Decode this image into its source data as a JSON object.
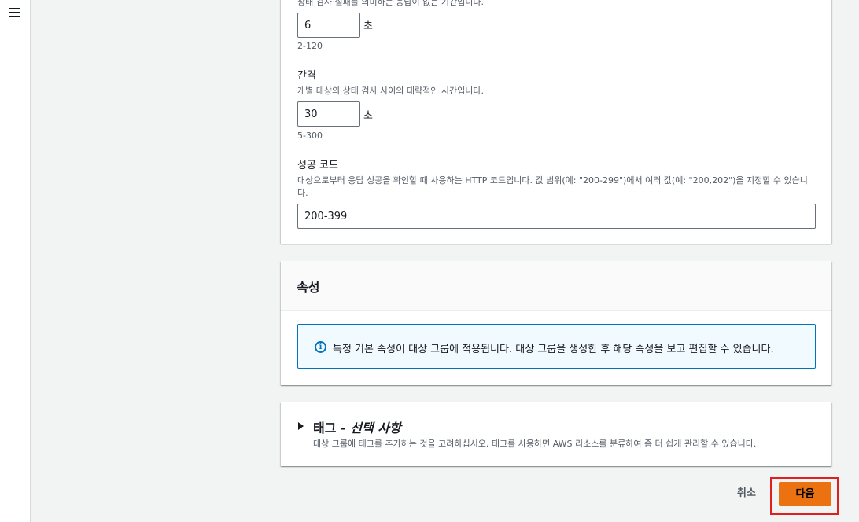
{
  "nav": {
    "menu_icon": "hamburger-menu-icon"
  },
  "health_check": {
    "timeout": {
      "description": "상태 검사 실패를 의미하는 응답이 없는 기간입니다.",
      "value": "6",
      "unit": "초",
      "range": "2-120"
    },
    "interval": {
      "label": "간격",
      "description": "개별 대상의 상태 검사 사이의 대략적인 시간입니다.",
      "value": "30",
      "unit": "초",
      "range": "5-300"
    },
    "success_codes": {
      "label": "성공 코드",
      "description_line1": "대상으로부터 응답 성공을 확인할 때 사용하는 HTTP 코드입니다. 값 범위(예: \"200-299\")에서 여러 값(예: \"200,202\")을 지정할 수 있습니",
      "description_line2": "다.",
      "value": "200-399"
    }
  },
  "attributes": {
    "title": "속성",
    "info_icon": "info-icon",
    "info_text": "특정 기본 속성이 대상 그룹에 적용됩니다. 대상 그룹을 생성한 후 해당 속성을 보고 편집할 수 있습니다."
  },
  "tags": {
    "title_main": "태그 - ",
    "title_optional": "선택 사항",
    "description": "대상 그룹에 태그를 추가하는 것을 고려하십시오. 태그를 사용하면 AWS 리소스를 분류하여 좀 더 쉽게 관리할 수 있습니다."
  },
  "actions": {
    "cancel_label": "취소",
    "next_label": "다음"
  },
  "colors": {
    "primary_button": "#ec7211",
    "highlight_border": "#e02020",
    "info_border": "#0073bb"
  }
}
